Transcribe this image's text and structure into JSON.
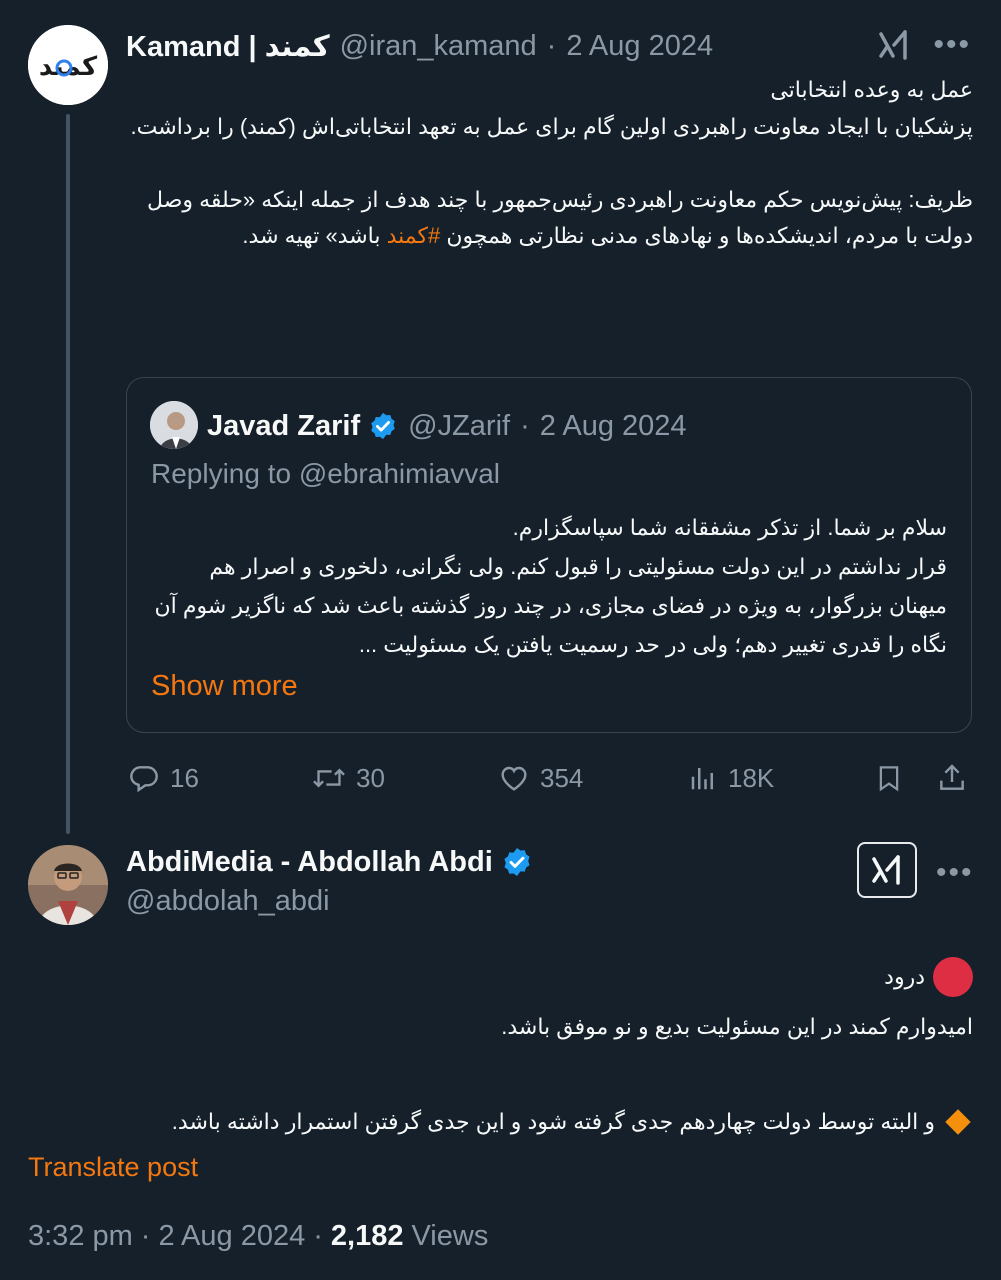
{
  "colors": {
    "background": "#15202b",
    "accent": "#f4770f",
    "muted": "#8b98a5",
    "verified": "#1d9bf0"
  },
  "tweet1": {
    "author_name": "Kamand | کمند",
    "handle": "@iran_kamand",
    "separator": "·",
    "date": "2 Aug 2024",
    "body_part1": "عمل به وعده انتخاباتی\nپزشکیان با ایجاد معاونت راهبردی اولین گام برای عمل به تعهد انتخاباتی‌اش (کمند) را برداشت.\n\nظریف: پیش‌نویس حکم معاونت راهبردی رئیس‌جمهور با چند هدف از جمله اینکه «حلقه وصل دولت با مردم، اندیشکده‌ها و نهادهای مدنی نظارتی همچون ",
    "hashtag": "#کمند",
    "body_part2": " باشد» تهیه شد.",
    "quote": {
      "author_name": "Javad Zarif",
      "handle": "@JZarif",
      "separator": "·",
      "date": "2 Aug 2024",
      "replying_to": "Replying to @ebrahimiavval",
      "body": "سلام بر شما. از تذکر مشفقانه شما سپاسگزارم.\nقرار نداشتم در این دولت مسئولیتی را قبول کنم.  ولی نگرانی، دلخوری و اصرار هم میهنان بزرگوار، به ویژه در فضای مجازی، در چند روز گذشته باعث شد که ناگزیر شوم آن نگاه را قدری تغییر دهم؛ ولی در حد رسمیت یافتن یک مسئولیت ...",
      "show_more": "Show more"
    },
    "actions": {
      "replies": "16",
      "reposts": "30",
      "likes": "354",
      "views": "18K"
    }
  },
  "tweet2": {
    "author_name": "AbdiMedia - Abdollah Abdi",
    "handle": "@abdolah_abdi",
    "line1": "درود",
    "line2": "امیدوارم کمند در این مسئولیت بدیع و نو موفق باشد.",
    "line3": "و البته توسط دولت چهاردهم جدی گرفته شود و این جدی گرفتن استمرار داشته باشد.",
    "translate": "Translate post",
    "time": "3:32 pm",
    "separator": "·",
    "date": "2 Aug 2024",
    "separator2": "·",
    "views_count": "2,182",
    "views_label": "Views"
  },
  "icons": {
    "avatar1_logo_text": "کمند",
    "reply": "reply-icon",
    "repost": "repost-icon",
    "like": "heart-icon",
    "views": "views-icon",
    "bookmark": "bookmark-icon",
    "share": "share-icon",
    "grok": "grok-icon",
    "more": "more-icon"
  }
}
